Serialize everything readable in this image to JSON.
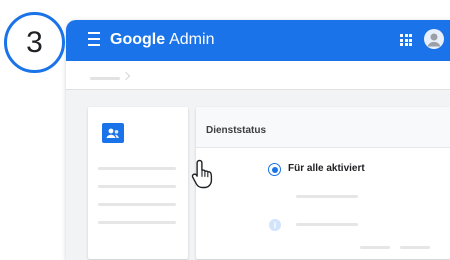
{
  "step": {
    "number": "3"
  },
  "header": {
    "brand_google": "Google",
    "brand_admin": "Admin",
    "menu_icon": "hamburger-menu-icon",
    "apps_icon": "apps-grid-icon",
    "account_icon": "account-avatar-icon",
    "color": "#1a73e8"
  },
  "service_card": {
    "title": "Dienststatus",
    "option_selected_label": "Für alle aktiviert",
    "option_selected": true
  },
  "cursor": {
    "icon": "hand-pointer-icon"
  }
}
